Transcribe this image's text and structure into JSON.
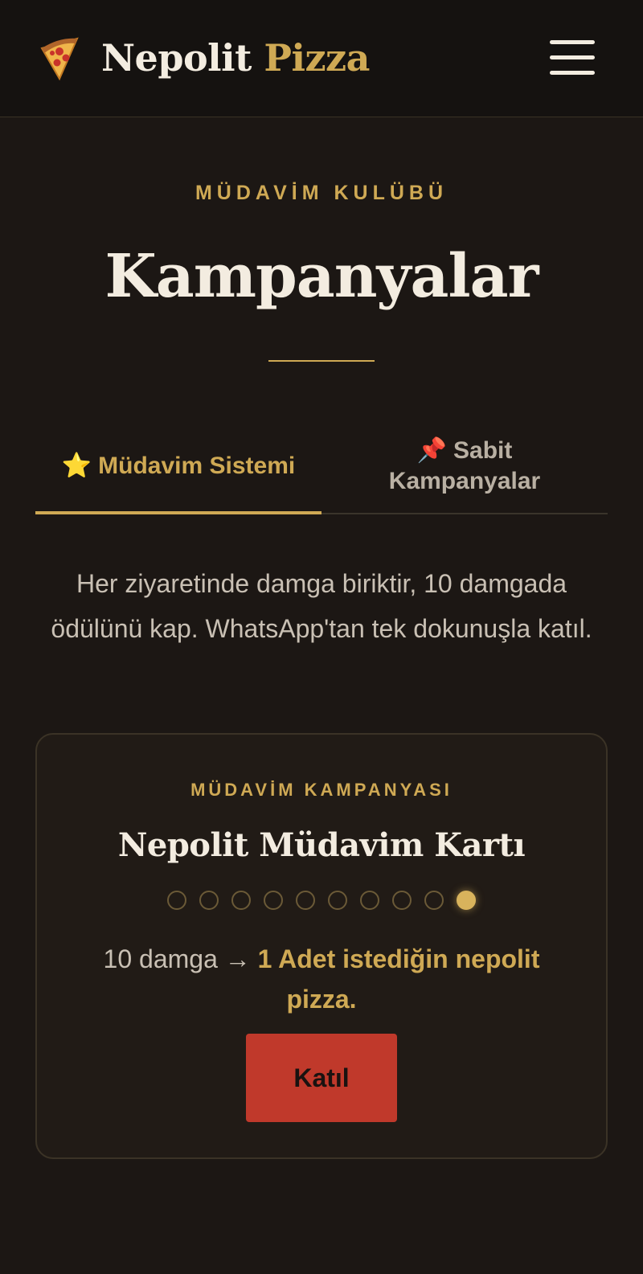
{
  "header": {
    "brand_main": "Nepolit",
    "brand_accent": "Pizza",
    "logo_icon": "pizza-slice-icon",
    "menu_icon": "hamburger-menu-icon"
  },
  "hero": {
    "eyebrow": "MÜDAVİM KULÜBÜ",
    "title": "Kampanyalar"
  },
  "tabs": [
    {
      "icon": "⭐",
      "label": "Müdavim Sistemi",
      "active": true
    },
    {
      "icon": "📌",
      "label": "Sabit Kampanyalar",
      "active": false
    }
  ],
  "description": "Her ziyaretinde damga biriktir, 10 damgada ödülünü kap. WhatsApp'tan tek dokunuşla katıl.",
  "card": {
    "eyebrow": "MÜDAVİM KAMPANYASI",
    "title": "Nepolit Müdavim Kartı",
    "stamps_total": 10,
    "stamps_filled": 1,
    "reward_prefix": "10 damga →",
    "reward_highlight": "1 Adet istediğin nepolit pizza.",
    "button_label": "Katıl"
  },
  "colors": {
    "background": "#1c1714",
    "accent_gold": "#cfa954",
    "button_red": "#c0392b",
    "text_light": "#f3ece0"
  }
}
